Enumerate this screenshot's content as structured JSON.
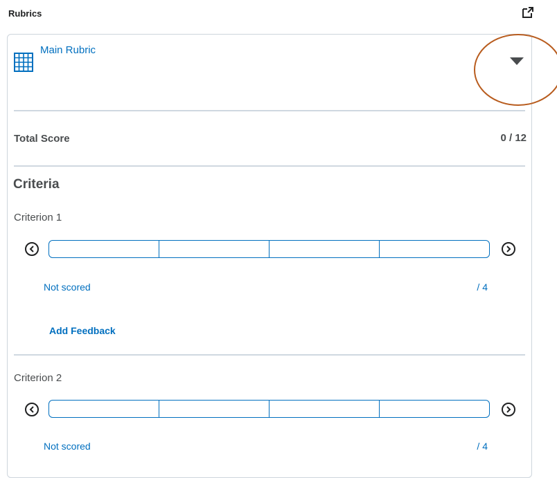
{
  "panel": {
    "title": "Rubrics",
    "popout_icon": "popout-icon"
  },
  "rubric": {
    "name": "Main Rubric",
    "icon": "grid-icon",
    "dropdown_icon": "caret-down-icon",
    "annotation_color": "#b85c1e"
  },
  "total": {
    "label": "Total Score",
    "value": "0 / 12"
  },
  "criteria": {
    "heading": "Criteria",
    "items": [
      {
        "label": "Criterion 1",
        "status": "Not scored",
        "out_of": "/ 4",
        "feedback_label": "Add Feedback",
        "levels": 4
      },
      {
        "label": "Criterion 2",
        "status": "Not scored",
        "out_of": "/ 4",
        "levels": 4
      }
    ]
  },
  "colors": {
    "link": "#006fbf",
    "divider": "#cfd8e0",
    "text": "#494c4e"
  }
}
